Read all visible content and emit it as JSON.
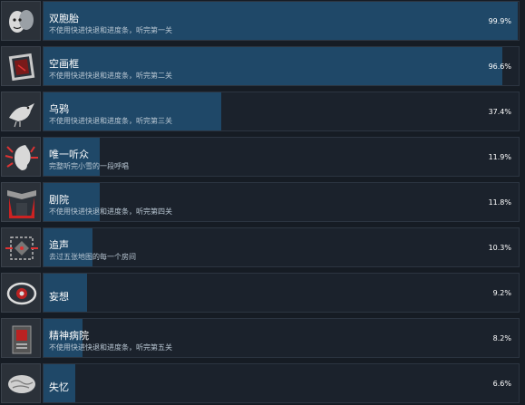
{
  "achievements": [
    {
      "title": "双胞胎",
      "description": "不使用快进快退和进度条，听完第一关",
      "percent": "99.9%",
      "fraction": 0.999,
      "icon": "masks-icon"
    },
    {
      "title": "空画框",
      "description": "不使用快进快退和进度条，听完第二关",
      "percent": "96.6%",
      "fraction": 0.966,
      "icon": "picture-frame-icon"
    },
    {
      "title": "乌鸦",
      "description": "不使用快进快退和进度条，听完第三关",
      "percent": "37.4%",
      "fraction": 0.374,
      "icon": "crow-icon"
    },
    {
      "title": "唯一听众",
      "description": "完整听完小雪的一段呼唱",
      "percent": "11.9%",
      "fraction": 0.119,
      "icon": "ear-icon"
    },
    {
      "title": "剧院",
      "description": "不使用快进快退和进度条，听完第四关",
      "percent": "11.8%",
      "fraction": 0.118,
      "icon": "theater-icon"
    },
    {
      "title": "追声",
      "description": "去过五张地图的每一个房间",
      "percent": "10.3%",
      "fraction": 0.103,
      "icon": "map-icon"
    },
    {
      "title": "妄想",
      "description": "",
      "percent": "9.2%",
      "fraction": 0.092,
      "icon": "eye-icon"
    },
    {
      "title": "精神病院",
      "description": "不使用快进快退和进度条，听完第五关",
      "percent": "8.2%",
      "fraction": 0.082,
      "icon": "asylum-icon"
    },
    {
      "title": "失忆",
      "description": "",
      "percent": "6.6%",
      "fraction": 0.066,
      "icon": "brain-icon"
    }
  ],
  "colors": {
    "fill": "#1f4868",
    "background": "#161c24",
    "accent": "#66c0f4"
  }
}
